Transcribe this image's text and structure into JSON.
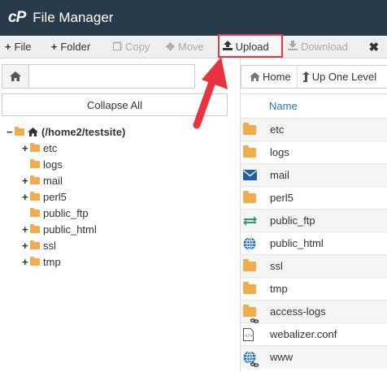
{
  "app": {
    "logo": "cP",
    "title": "File Manager"
  },
  "toolbar": {
    "file": "File",
    "folder": "Folder",
    "copy": "Copy",
    "move": "Move",
    "upload": "Upload",
    "download": "Download"
  },
  "left": {
    "collapse": "Collapse All",
    "root": "(/home2/testsite)",
    "tree": [
      {
        "label": "etc",
        "expandable": true
      },
      {
        "label": "logs",
        "expandable": false
      },
      {
        "label": "mail",
        "expandable": true
      },
      {
        "label": "perl5",
        "expandable": true
      },
      {
        "label": "public_ftp",
        "expandable": false
      },
      {
        "label": "public_html",
        "expandable": true
      },
      {
        "label": "ssl",
        "expandable": true
      },
      {
        "label": "tmp",
        "expandable": true
      }
    ]
  },
  "right": {
    "home": "Home",
    "up_one_level": "Up One Level",
    "column_name": "Name",
    "files": [
      {
        "name": "etc",
        "icon": "folder-icon"
      },
      {
        "name": "logs",
        "icon": "folder-icon"
      },
      {
        "name": "mail",
        "icon": "mail-icon"
      },
      {
        "name": "perl5",
        "icon": "folder-icon"
      },
      {
        "name": "public_ftp",
        "icon": "ftp-transfer-icon"
      },
      {
        "name": "public_html",
        "icon": "globe-icon"
      },
      {
        "name": "ssl",
        "icon": "folder-icon"
      },
      {
        "name": "tmp",
        "icon": "folder-icon"
      },
      {
        "name": "access-logs",
        "icon": "folder-link-icon"
      },
      {
        "name": "webalizer.conf",
        "icon": "code-file-icon"
      },
      {
        "name": "www",
        "icon": "globe-link-icon"
      }
    ]
  },
  "colors": {
    "titlebar": "#293a4a",
    "folder": "#f0ad4e",
    "highlight": "#e8343e",
    "link": "#2a74c3"
  }
}
